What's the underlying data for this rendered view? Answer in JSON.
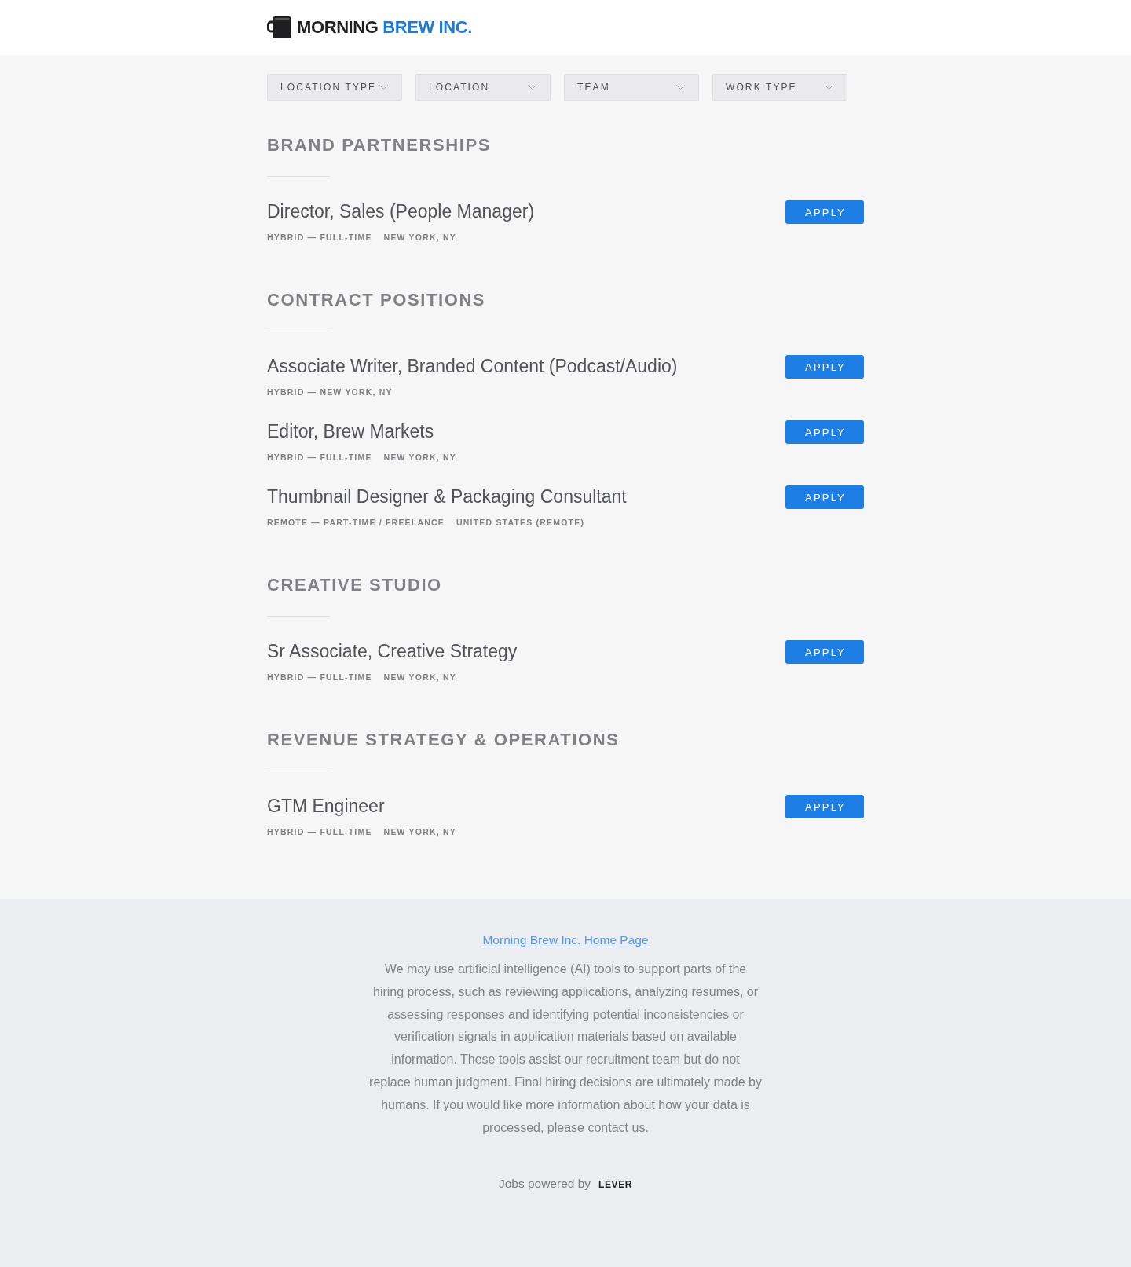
{
  "header": {
    "logo": {
      "word_1": "MORNING",
      "word_2": "BREW INC."
    }
  },
  "filters": [
    "LOCATION TYPE",
    "LOCATION",
    "TEAM",
    "WORK TYPE"
  ],
  "sections": [
    {
      "title": "BRAND PARTNERSHIPS",
      "postings": [
        {
          "title": "Director, Sales (People Manager)",
          "tags": [
            "HYBRID — FULL-TIME",
            "NEW YORK, NY"
          ],
          "button": "APPLY"
        }
      ]
    },
    {
      "title": "CONTRACT POSITIONS",
      "postings": [
        {
          "title": "Associate Writer, Branded Content (Podcast/Audio)",
          "tags": [
            "HYBRID — NEW YORK, NY"
          ],
          "button": "APPLY"
        },
        {
          "title": "Editor, Brew Markets",
          "tags": [
            "HYBRID — FULL-TIME",
            "NEW YORK, NY"
          ],
          "button": "APPLY"
        },
        {
          "title": "Thumbnail Designer & Packaging Consultant",
          "tags": [
            "REMOTE — PART-TIME / FREELANCE",
            "UNITED STATES (REMOTE)"
          ],
          "button": "APPLY"
        }
      ]
    },
    {
      "title": "CREATIVE STUDIO",
      "postings": [
        {
          "title": "Sr Associate, Creative Strategy",
          "tags": [
            "HYBRID — FULL-TIME",
            "NEW YORK, NY"
          ],
          "button": "APPLY"
        }
      ]
    },
    {
      "title": "REVENUE STRATEGY & OPERATIONS",
      "postings": [
        {
          "title": "GTM Engineer",
          "tags": [
            "HYBRID — FULL-TIME",
            "NEW YORK, NY"
          ],
          "button": "APPLY"
        }
      ]
    }
  ],
  "footer": {
    "link": "Morning Brew Inc. Home Page",
    "disclaimer": "We may use artificial intelligence (AI) tools to support parts of the hiring process, such as reviewing applications, analyzing resumes, or assessing responses and identifying potential inconsistencies or verification signals in application materials based on available information. These tools assist our recruitment team but do not replace human judgment. Final hiring decisions are ultimately made by humans. If you would like more information about how your data is processed, please contact us.",
    "powered_by": "Jobs powered by",
    "brand": "LEVER"
  }
}
